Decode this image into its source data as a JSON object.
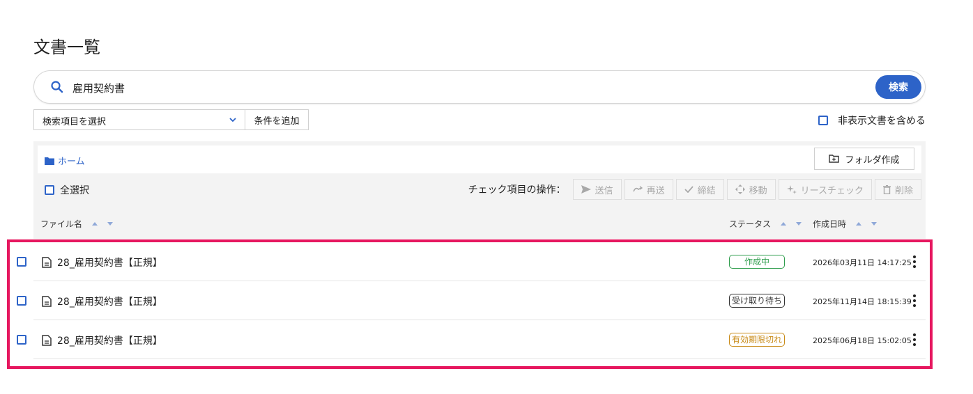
{
  "page": {
    "title": "文書一覧"
  },
  "search": {
    "query": "雇用契約書",
    "button_label": "検索"
  },
  "filters": {
    "field_select": "検索項目を選択",
    "add_condition_label": "条件を追加",
    "include_hidden_label": "非表示文書を含める"
  },
  "breadcrumb": {
    "home_label": "ホーム"
  },
  "toolbar": {
    "create_folder_label": "フォルダ作成",
    "select_all_label": "全選択",
    "bulk_label": "チェック項目の操作：",
    "actions": [
      {
        "label": "送信",
        "icon": "send-icon"
      },
      {
        "label": "再送",
        "icon": "resend-icon"
      },
      {
        "label": "締結",
        "icon": "check-icon"
      },
      {
        "label": "移動",
        "icon": "move-icon"
      },
      {
        "label": "リースチェック",
        "icon": "lease-check-icon"
      },
      {
        "label": "削除",
        "icon": "trash-icon"
      }
    ]
  },
  "table": {
    "columns": {
      "filename": "ファイル名",
      "status": "ステータス",
      "created": "作成日時"
    },
    "rows": [
      {
        "name": "28_雇用契約書【正規】",
        "status": "作成中",
        "status_color": "#2e9d4c",
        "created": "2026年03月11日 14:17:25"
      },
      {
        "name": "28_雇用契約書【正規】",
        "status": "受け取り待ち",
        "status_color": "#333333",
        "created": "2025年11月14日 18:15:39"
      },
      {
        "name": "28_雇用契約書【正規】",
        "status": "有効期限切れ",
        "status_color": "#c88a16",
        "created": "2025年06月18日 15:02:05"
      }
    ]
  },
  "colors": {
    "accent": "#2d63c8",
    "highlight": "#e6175f"
  }
}
